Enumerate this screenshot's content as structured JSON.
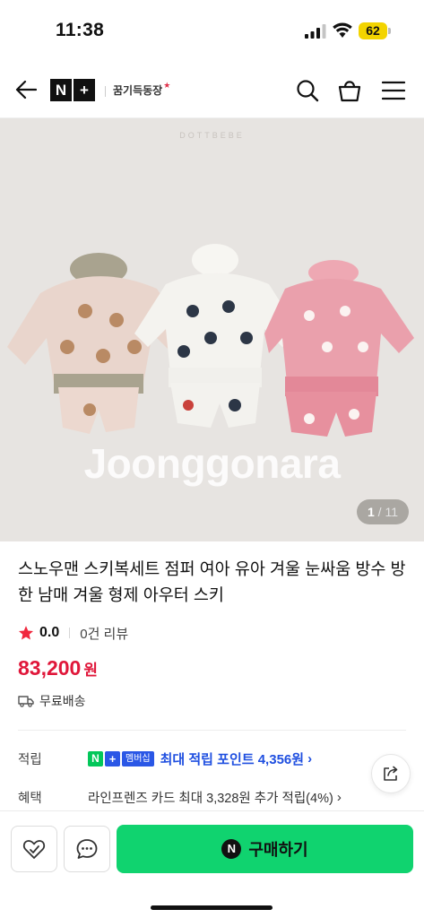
{
  "status_bar": {
    "time": "11:38",
    "battery": "62"
  },
  "header": {
    "logo_n": "N",
    "logo_plus": "+",
    "store_name": "꿈기득동장"
  },
  "product_image": {
    "brand_watermark": "DOTTBEBE",
    "site_watermark": "Joonggonara",
    "counter_current": "1",
    "counter_separator": " / ",
    "counter_total": "11"
  },
  "product": {
    "title": "스노우맨 스키복세트 점퍼 여아 유아 겨울 눈싸움 방수 방한 남매 겨울 형제 아우터 스키",
    "rating": "0.0",
    "review_count": "0건 리뷰",
    "price": "83,200",
    "price_unit": "원",
    "shipping": "무료배송"
  },
  "points": {
    "label": "적립",
    "badge_n": "N",
    "badge_plus": "+",
    "badge_member": "멤버십",
    "text": "최대 적립 포인트 4,356원",
    "chevron": "›"
  },
  "benefit": {
    "label": "혜택",
    "text": "라인프렌즈 카드 최대 3,328원 추가 적립(4%)",
    "chevron": "›"
  },
  "bottom_bar": {
    "pay_icon": "N",
    "buy_label": "구매하기"
  },
  "colors": {
    "price": "#e0173a",
    "points": "#1f4fe0",
    "buy_button": "#10d36f",
    "naver_green": "#03c75a"
  }
}
